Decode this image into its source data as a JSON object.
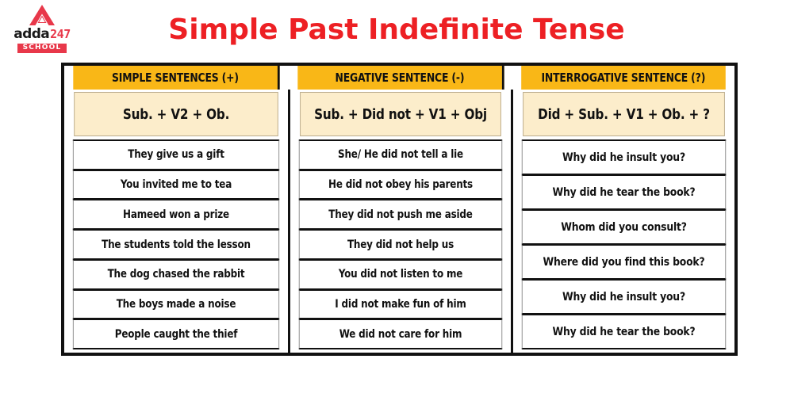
{
  "brand": {
    "icon": "adda247-triangle-logo",
    "word_primary": "adda",
    "word_secondary": "247",
    "subtitle": "SCHOOL",
    "color_red": "#e8384a",
    "color_dark": "#1a1a1a"
  },
  "page": {
    "title": "Simple Past Indefinite Tense",
    "title_color": "#ED2024",
    "background": "#ffffff"
  },
  "colors": {
    "header_amber": "#F9B717",
    "formula_cream": "#FCEDCB",
    "border_black": "#111111",
    "text_black": "#111111"
  },
  "table": {
    "columns": [
      {
        "header": "SIMPLE SENTENCES (+)",
        "formula": "Sub. + V2 + Ob.",
        "sentences": [
          "They give us a gift",
          "You invited me to tea",
          "Hameed won a prize",
          "The students told the lesson",
          "The dog chased the rabbit",
          "The boys made a noise",
          "People caught the thief"
        ]
      },
      {
        "header": "NEGATIVE SENTENCE (-)",
        "formula": "Sub. + Did not + V1 + Obj",
        "sentences": [
          "She/ He did not tell a lie",
          "He did not obey his parents",
          "They did not push me aside",
          "They did not help us",
          "You did not listen to me",
          "I did not make fun of him",
          "We did not care for him"
        ]
      },
      {
        "header": "INTERROGATIVE SENTENCE (?)",
        "formula": "Did + Sub. + V1 + Ob. + ?",
        "sentences": [
          "Why did he insult you?",
          "Why did he tear the book?",
          "Whom did you consult?",
          "Where did you find this book?",
          "Why did he insult you?",
          "Why did he tear the book?"
        ]
      }
    ]
  }
}
